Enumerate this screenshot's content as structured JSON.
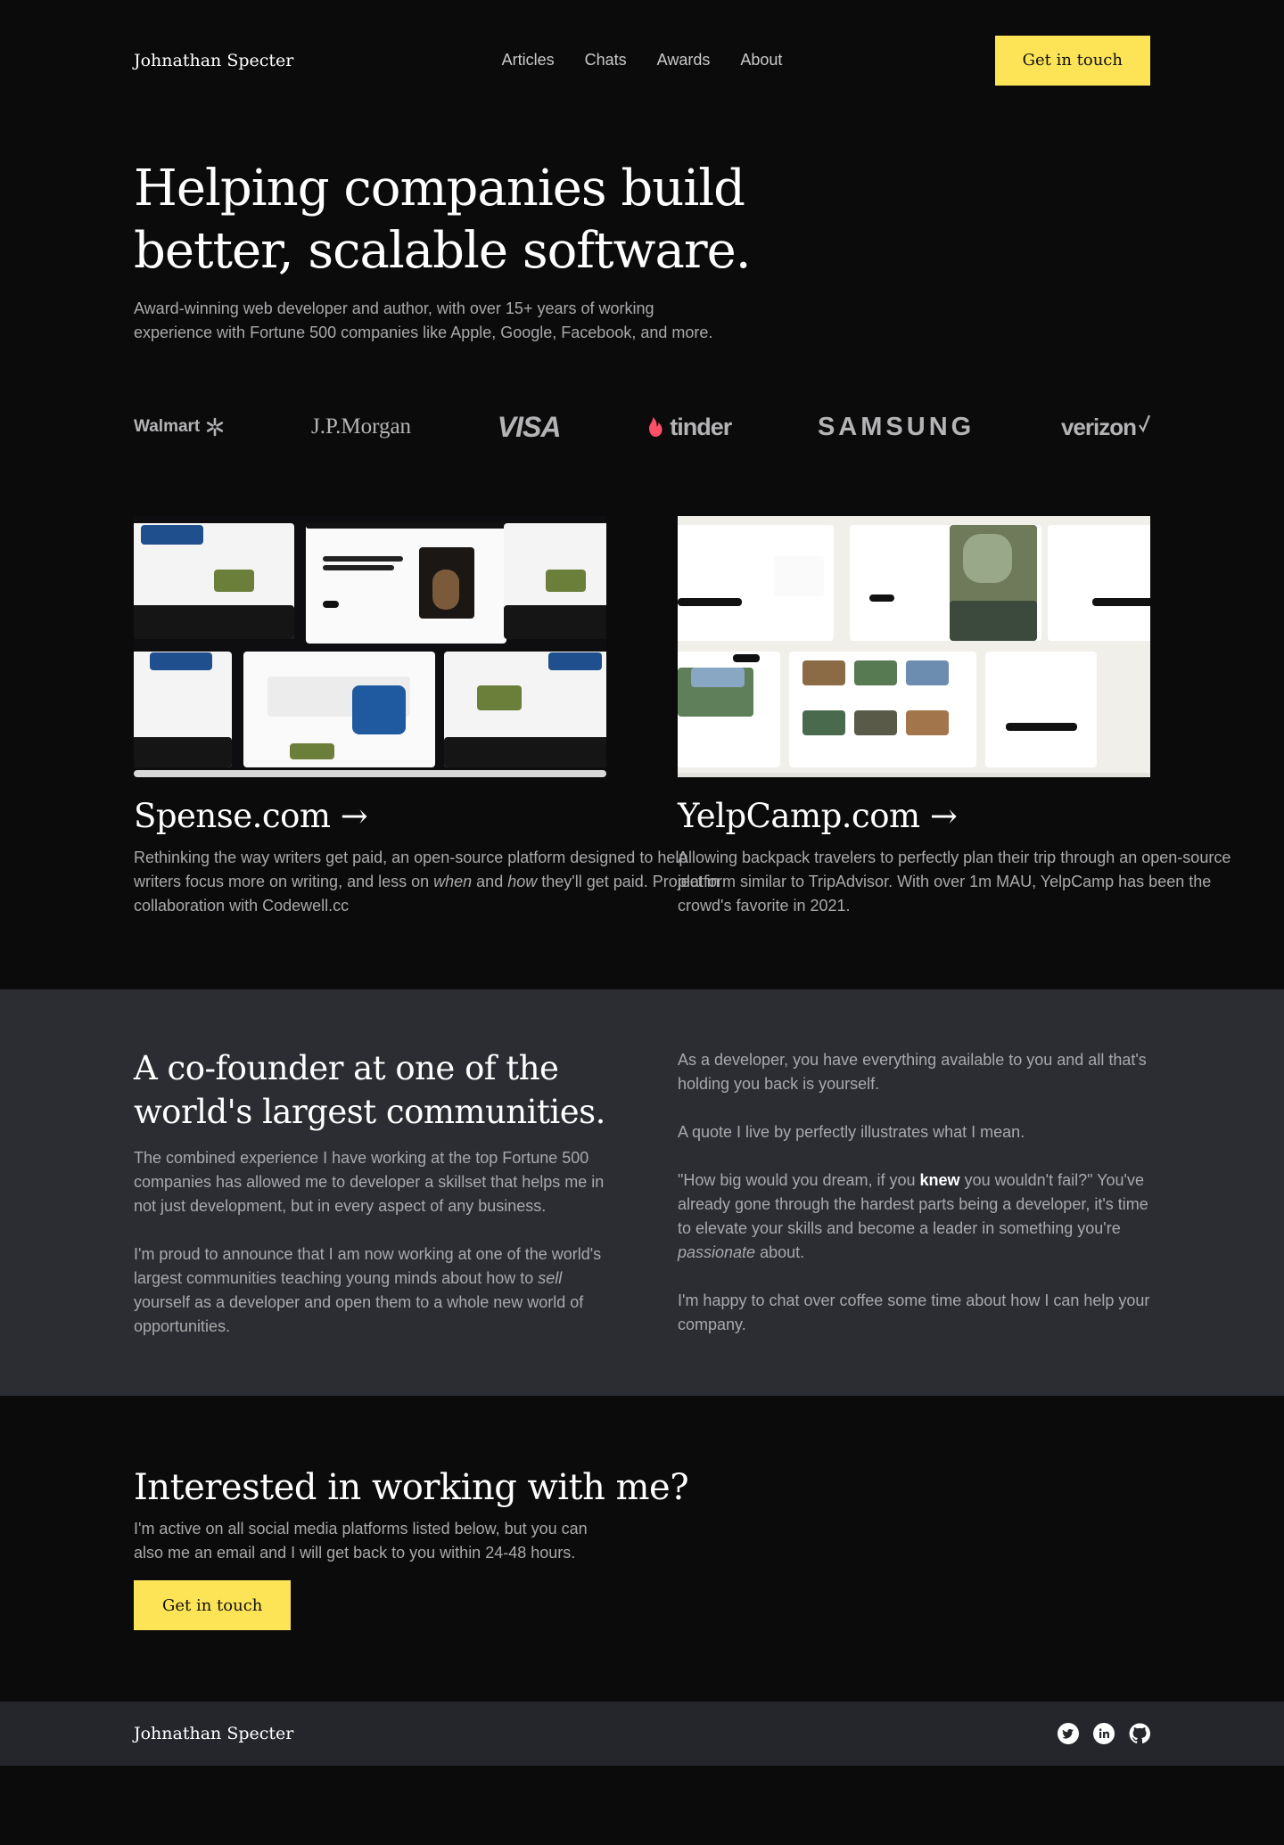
{
  "brand": "Johnathan Specter",
  "nav": {
    "items": [
      "Articles",
      "Chats",
      "Awards",
      "About"
    ]
  },
  "header": {
    "cta": "Get in touch"
  },
  "hero": {
    "title": "Helping companies build better, scalable software.",
    "subtitle": "Award-winning web developer and author, with over 15+ years of working experience with Fortune 500 companies like Apple, Google, Facebook, and more."
  },
  "logos": [
    "Walmart",
    "J.P.Morgan",
    "VISA",
    "tinder",
    "SAMSUNG",
    "verizon"
  ],
  "projects": [
    {
      "title": "Spense.com →",
      "desc_a": "Rethinking the way writers get paid, an open-source platform designed to help writers focus more on writing, and less on ",
      "desc_em1": "when",
      "desc_b": " and ",
      "desc_em2": "how",
      "desc_c": " they'll get paid. Project in collaboration with Codewell.cc"
    },
    {
      "title": "YelpCamp.com →",
      "desc": "Allowing backpack travelers to perfectly plan their trip through an open-source platform similar to TripAdvisor. With over 1m MAU, YelpCamp has been the crowd's favorite in 2021."
    }
  ],
  "cofounder": {
    "title": "A co-founder at one of the world's largest communities.",
    "left_p1": "The combined experience I have working at the top Fortune 500 companies has allowed me to developer a skillset that helps me in not just development, but in every aspect of any business.",
    "left_p2_a": "I'm proud to announce that I am now working at one of the world's largest communities teaching young minds about how to ",
    "left_p2_em": "sell",
    "left_p2_b": " yourself as a developer and open them to a whole new world of opportunities.",
    "right_p1": "As a developer, you have everything available to you and all that's holding you back is yourself.",
    "right_p2": "A quote I live by perfectly illustrates what I mean.",
    "right_p3_a": "\"How big would you dream, if you ",
    "right_p3_b": "knew",
    "right_p3_c": " you wouldn't fail?\" You've already gone through the hardest parts being a developer, it's time to elevate your skills and become a leader in something you're ",
    "right_p3_em": "passionate",
    "right_p3_d": " about.",
    "right_p4": "I'm happy to chat over coffee some time about how I can help your company."
  },
  "contact": {
    "title": "Interested in working with me?",
    "desc": "I'm active on all social media platforms listed below, but you can also me an email and I will get back to you within 24-48 hours.",
    "cta": "Get in touch"
  },
  "footer": {
    "brand": "Johnathan Specter",
    "social": [
      "twitter-icon",
      "linkedin-icon",
      "github-icon"
    ]
  },
  "colors": {
    "accent": "#fde457",
    "bg": "#0b0b0c",
    "panel": "#2b2d33",
    "footer": "#24262c"
  }
}
